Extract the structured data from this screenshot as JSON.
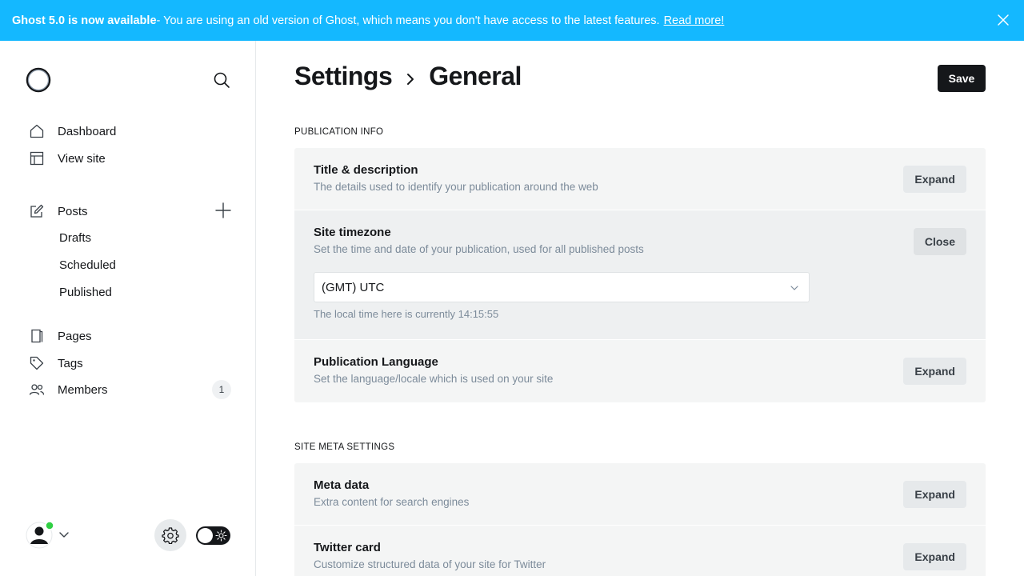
{
  "banner": {
    "headline": "Ghost 5.0 is now available",
    "message": " - You are using an old version of Ghost, which means you don't have access to the latest features.",
    "link": "Read more!",
    "close_icon": "close-icon"
  },
  "sidebar": {
    "logo_icon": "ghost-logo",
    "search_icon": "search-icon",
    "items": {
      "dashboard": "Dashboard",
      "view_site": "View site",
      "posts": "Posts",
      "drafts": "Drafts",
      "scheduled": "Scheduled",
      "published": "Published",
      "pages": "Pages",
      "tags": "Tags",
      "members": "Members",
      "members_count": "1"
    }
  },
  "header": {
    "crumb_root": "Settings",
    "crumb_current": "General",
    "save_label": "Save"
  },
  "sections": {
    "publication_info": {
      "title": "Publication info",
      "title_desc": {
        "title": "Title & description",
        "desc": "The details used to identify your publication around the web",
        "button": "Expand"
      },
      "timezone": {
        "title": "Site timezone",
        "desc": "Set the time and date of your publication, used for all published posts",
        "button": "Close",
        "selected": "(GMT) UTC",
        "local_time": "The local time here is currently 14:15:55"
      },
      "language": {
        "title": "Publication Language",
        "desc": "Set the language/locale which is used on your site",
        "button": "Expand"
      }
    },
    "site_meta": {
      "title": "Site meta settings",
      "meta_data": {
        "title": "Meta data",
        "desc": "Extra content for search engines",
        "button": "Expand"
      },
      "twitter": {
        "title": "Twitter card",
        "desc": "Customize structured data of your site for Twitter",
        "button": "Expand"
      }
    }
  },
  "colors": {
    "banner": "#14b8ff",
    "primary_button": "#15171a",
    "online": "#30cf43"
  }
}
